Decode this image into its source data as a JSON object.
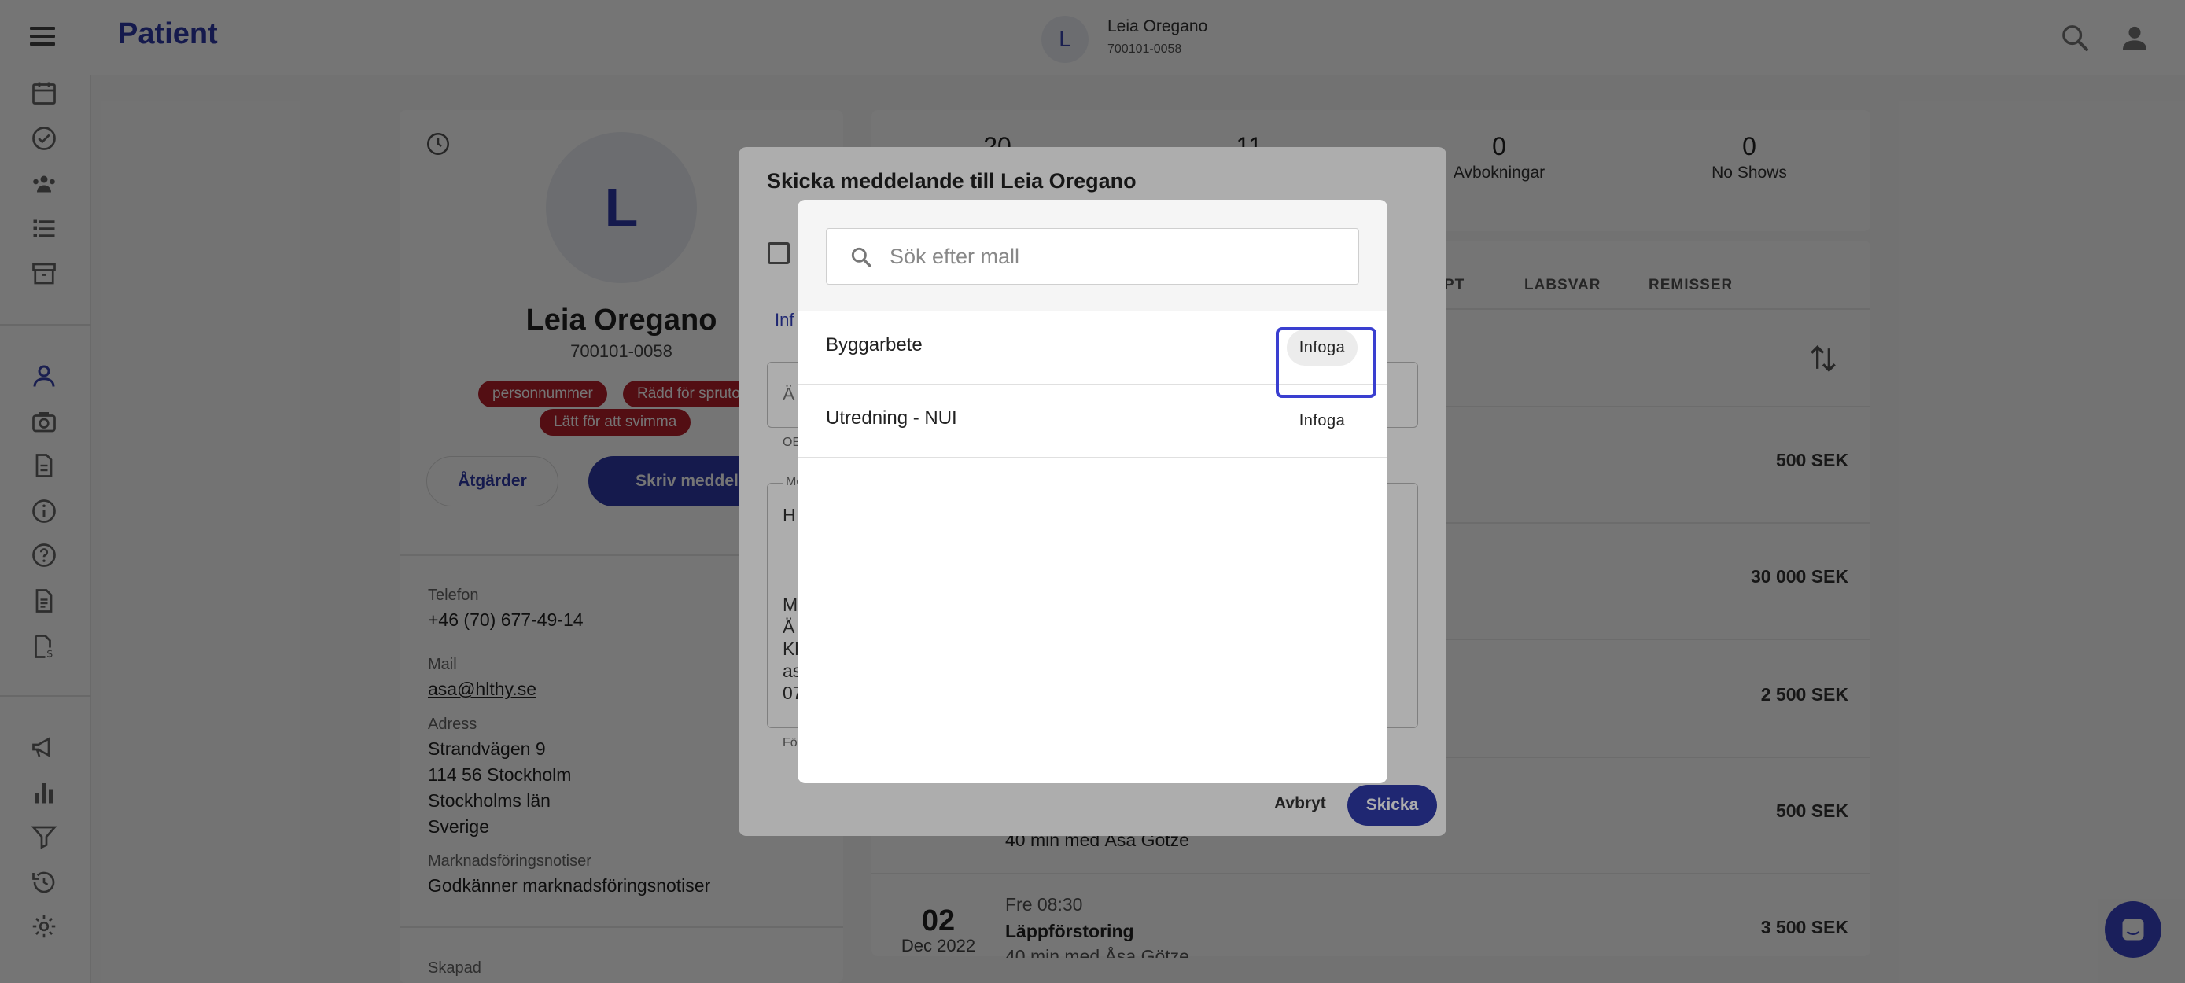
{
  "header": {
    "title": "Patient",
    "avatar_letter": "L",
    "patient_name": "Leia Oregano",
    "patient_id": "700101-0058"
  },
  "sidebar": {
    "items": [
      "calendar-icon",
      "check-circle-icon",
      "group-icon",
      "list-icon",
      "archive-icon",
      "person-icon",
      "camera-icon",
      "document-icon",
      "info-icon",
      "help-icon",
      "invoice-icon",
      "report-icon",
      "megaphone-icon",
      "chart-icon",
      "filter-icon",
      "history-icon",
      "gear-icon"
    ]
  },
  "patient": {
    "avatar_letter": "L",
    "name": "Leia Oregano",
    "id": "700101-0058",
    "tags": [
      "personnummer",
      "Rädd för sprutor",
      "Lätt för att svimma"
    ],
    "actions_label": "Åtgärder",
    "write_label": "Skriv meddelande",
    "fields": {
      "phone_label": "Telefon",
      "phone": "+46 (70) 677-49-14",
      "mail_label": "Mail",
      "mail": "asa@hlthy.se",
      "address_label": "Adress",
      "address_lines": [
        "Strandvägen 9",
        "114 56 Stockholm",
        "Stockholms län",
        "Sverige"
      ],
      "marketing_label": "Marknadsföringsnotiser",
      "marketing_value": "Godkänner marknadsföringsnotiser",
      "created_label": "Skapad"
    }
  },
  "stats": [
    {
      "value": "20",
      "label": ""
    },
    {
      "value": "11",
      "label": ""
    },
    {
      "value": "0",
      "label": "Avbokningar"
    },
    {
      "value": "0",
      "label": "No Shows"
    }
  ],
  "tabs": [
    "PT",
    "LABSVAR",
    "REMISSER"
  ],
  "rows": [
    {
      "price": "500 SEK"
    },
    {
      "price": "30 000 SEK"
    },
    {
      "price": "2 500 SEK"
    },
    {
      "price": "500 SEK",
      "detail": "40 min med Åsa Götze"
    },
    {
      "day": "02",
      "month": "Dec 2022",
      "time": "Fre 08:30",
      "title": "Läppförstoring",
      "detail": "40 min med Åsa Götze",
      "price": "3 500 SEK"
    }
  ],
  "message_dialog": {
    "title": "Skicka meddelande till Leia Oregano",
    "info_text": "Inf",
    "subject_prefix": "Ä",
    "subject_note": "OE",
    "message_label": "Me",
    "message_lines": [
      "H",
      "M",
      "Ä",
      "Kl",
      "as",
      "07"
    ],
    "footer_note": "Fö",
    "cancel_label": "Avbryt",
    "send_label": "Skicka"
  },
  "template_picker": {
    "search_placeholder": "Sök efter mall",
    "templates": [
      {
        "name": "Byggarbete",
        "action": "Infoga"
      },
      {
        "name": "Utredning - NUI",
        "action": "Infoga"
      }
    ]
  },
  "colors": {
    "accent": "#2f3aa8",
    "tag": "#b5202c",
    "focus": "#3a3fd0"
  }
}
